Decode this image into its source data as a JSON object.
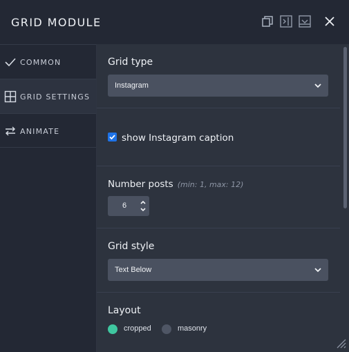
{
  "header": {
    "title": "GRID MODULE",
    "icons": [
      "copy-icon",
      "collapse-right-icon",
      "save-to-library-icon",
      "close-icon"
    ]
  },
  "sidebar": {
    "items": [
      {
        "label": "COMMON",
        "icon": "checkmark-icon",
        "active": false
      },
      {
        "label": "GRID SETTINGS",
        "icon": "grid-icon",
        "active": true
      },
      {
        "label": "ANIMATE",
        "icon": "swap-arrows-icon",
        "active": false
      }
    ]
  },
  "content": {
    "grid_type": {
      "label": "Grid type",
      "value": "Instagram"
    },
    "instagram_caption": {
      "label": "show Instagram caption",
      "checked": true
    },
    "number_posts": {
      "label": "Number posts",
      "hint": "(min: 1, max: 12)",
      "value": "6"
    },
    "grid_style": {
      "label": "Grid style",
      "value": "Text Below"
    },
    "layout": {
      "label": "Layout",
      "options": [
        {
          "label": "cropped",
          "selected": true
        },
        {
          "label": "masonry",
          "selected": false
        }
      ]
    }
  },
  "colors": {
    "panel_bg": "#232834",
    "content_bg": "#2d333e",
    "input_bg": "#4a5160",
    "accent_green": "#3fc7a0",
    "checkbox_blue": "#1e73e8"
  }
}
